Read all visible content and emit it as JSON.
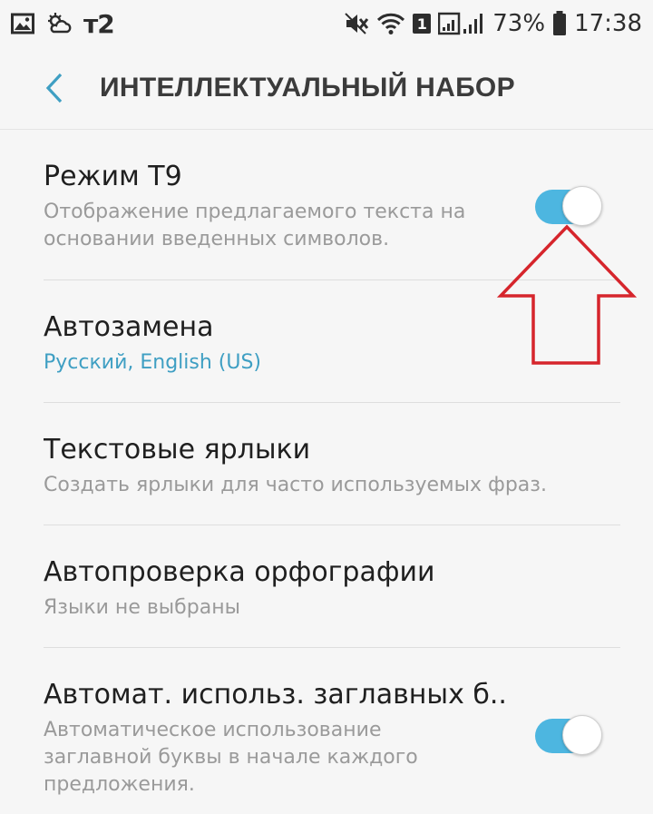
{
  "status_bar": {
    "carrier": "т2",
    "sim_slot": "1",
    "battery": "73%",
    "time": "17:38",
    "icons": [
      "gallery-icon",
      "weather-icon",
      "mute-icon",
      "wifi-icon",
      "signal-icon",
      "battery-icon"
    ]
  },
  "header": {
    "title": "ИНТЕЛЛЕКТУАЛЬНЫЙ НАБОР",
    "back_icon": "chevron-left-icon"
  },
  "settings": [
    {
      "title": "Режим Т9",
      "subtitle": "Отображение предлагаемого текста на основании введенных символов.",
      "toggle": true,
      "toggle_on": true
    },
    {
      "title": "Автозамена",
      "subtitle": "Русский, English (US)",
      "accent": true
    },
    {
      "title": "Текстовые ярлыки",
      "subtitle": "Создать ярлыки для часто используемых фраз."
    },
    {
      "title": "Автопроверка орфографии",
      "subtitle": "Языки не выбраны"
    },
    {
      "title": "Автомат. использ. заглавных б..",
      "subtitle": "Автоматическое использование заглавной буквы в начале каждого предложения.",
      "toggle": true,
      "toggle_on": true
    }
  ],
  "colors": {
    "background": "#f6f6f6",
    "toggle_on": "#4db6e0",
    "accent_text": "#3f9fc3",
    "annotation_arrow": "#d6252c"
  }
}
